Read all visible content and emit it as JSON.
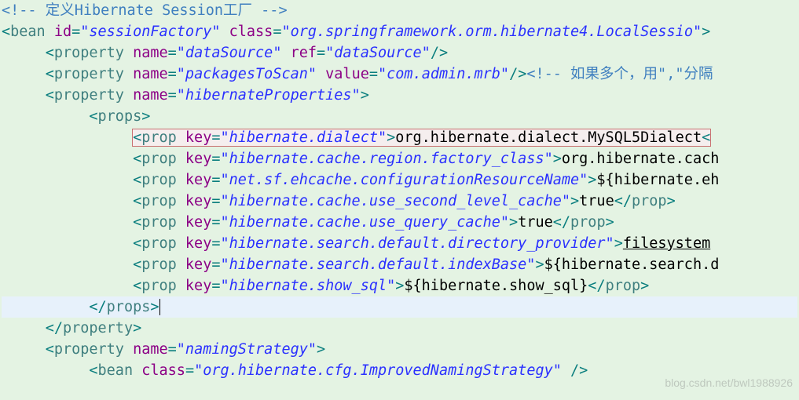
{
  "watermark": "blog.csdn.net/bwl1988926",
  "lines": [
    {
      "indent": 0,
      "type": "comment",
      "text": "<!-- 定义Hibernate Session工厂 -->"
    },
    {
      "indent": 0,
      "type": "open",
      "tag": "bean",
      "attrs": [
        [
          "id",
          "sessionFactory"
        ],
        [
          "class",
          "org.springframework.orm.hibernate4.LocalSessio"
        ]
      ],
      "trail": ""
    },
    {
      "indent": 1,
      "type": "self",
      "tag": "property",
      "attrs": [
        [
          "name",
          "dataSource"
        ],
        [
          "ref",
          "dataSource"
        ]
      ]
    },
    {
      "indent": 1,
      "type": "self",
      "tag": "property",
      "attrs": [
        [
          "name",
          "packagesToScan"
        ],
        [
          "value",
          "com.admin.mrb"
        ]
      ],
      "comment": "<!-- 如果多个，用\",\"分隔"
    },
    {
      "indent": 1,
      "type": "open",
      "tag": "property",
      "attrs": [
        [
          "name",
          "hibernateProperties"
        ]
      ]
    },
    {
      "indent": 2,
      "type": "open",
      "tag": "props",
      "attrs": []
    },
    {
      "indent": 3,
      "type": "prop",
      "key": "hibernate.dialect",
      "value": "org.hibernate.dialect.MySQL5Dialect",
      "highlight": true,
      "closeVisible": false
    },
    {
      "indent": 3,
      "type": "prop",
      "key": "hibernate.cache.region.factory_class",
      "value": "org.hibernate.cach",
      "closeVisible": false
    },
    {
      "indent": 3,
      "type": "prop",
      "key": "net.sf.ehcache.configurationResourceName",
      "value": "${hibernate.eh",
      "closeVisible": false
    },
    {
      "indent": 3,
      "type": "prop",
      "key": "hibernate.cache.use_second_level_cache",
      "value": "true",
      "closeVisible": true
    },
    {
      "indent": 3,
      "type": "prop",
      "key": "hibernate.cache.use_query_cache",
      "value": "true",
      "closeVisible": true
    },
    {
      "indent": 3,
      "type": "prop",
      "key": "hibernate.search.default.directory_provider",
      "value": "filesystem",
      "underline": true,
      "closeVisible": false
    },
    {
      "indent": 3,
      "type": "prop",
      "key": "hibernate.search.default.indexBase",
      "value": "${hibernate.search.d",
      "closeVisible": false
    },
    {
      "indent": 3,
      "type": "prop",
      "key": "hibernate.show_sql",
      "value": "${hibernate.show_sql}",
      "closeVisible": true
    },
    {
      "indent": 2,
      "type": "close",
      "tag": "props",
      "cursor": true
    },
    {
      "indent": 1,
      "type": "close",
      "tag": "property"
    },
    {
      "indent": 1,
      "type": "open",
      "tag": "property",
      "attrs": [
        [
          "name",
          "namingStrategy"
        ]
      ]
    },
    {
      "indent": 2,
      "type": "self",
      "tag": "bean",
      "attrs": [
        [
          "class",
          "org.hibernate.cfg.ImprovedNamingStrategy"
        ]
      ],
      "space": true
    }
  ]
}
